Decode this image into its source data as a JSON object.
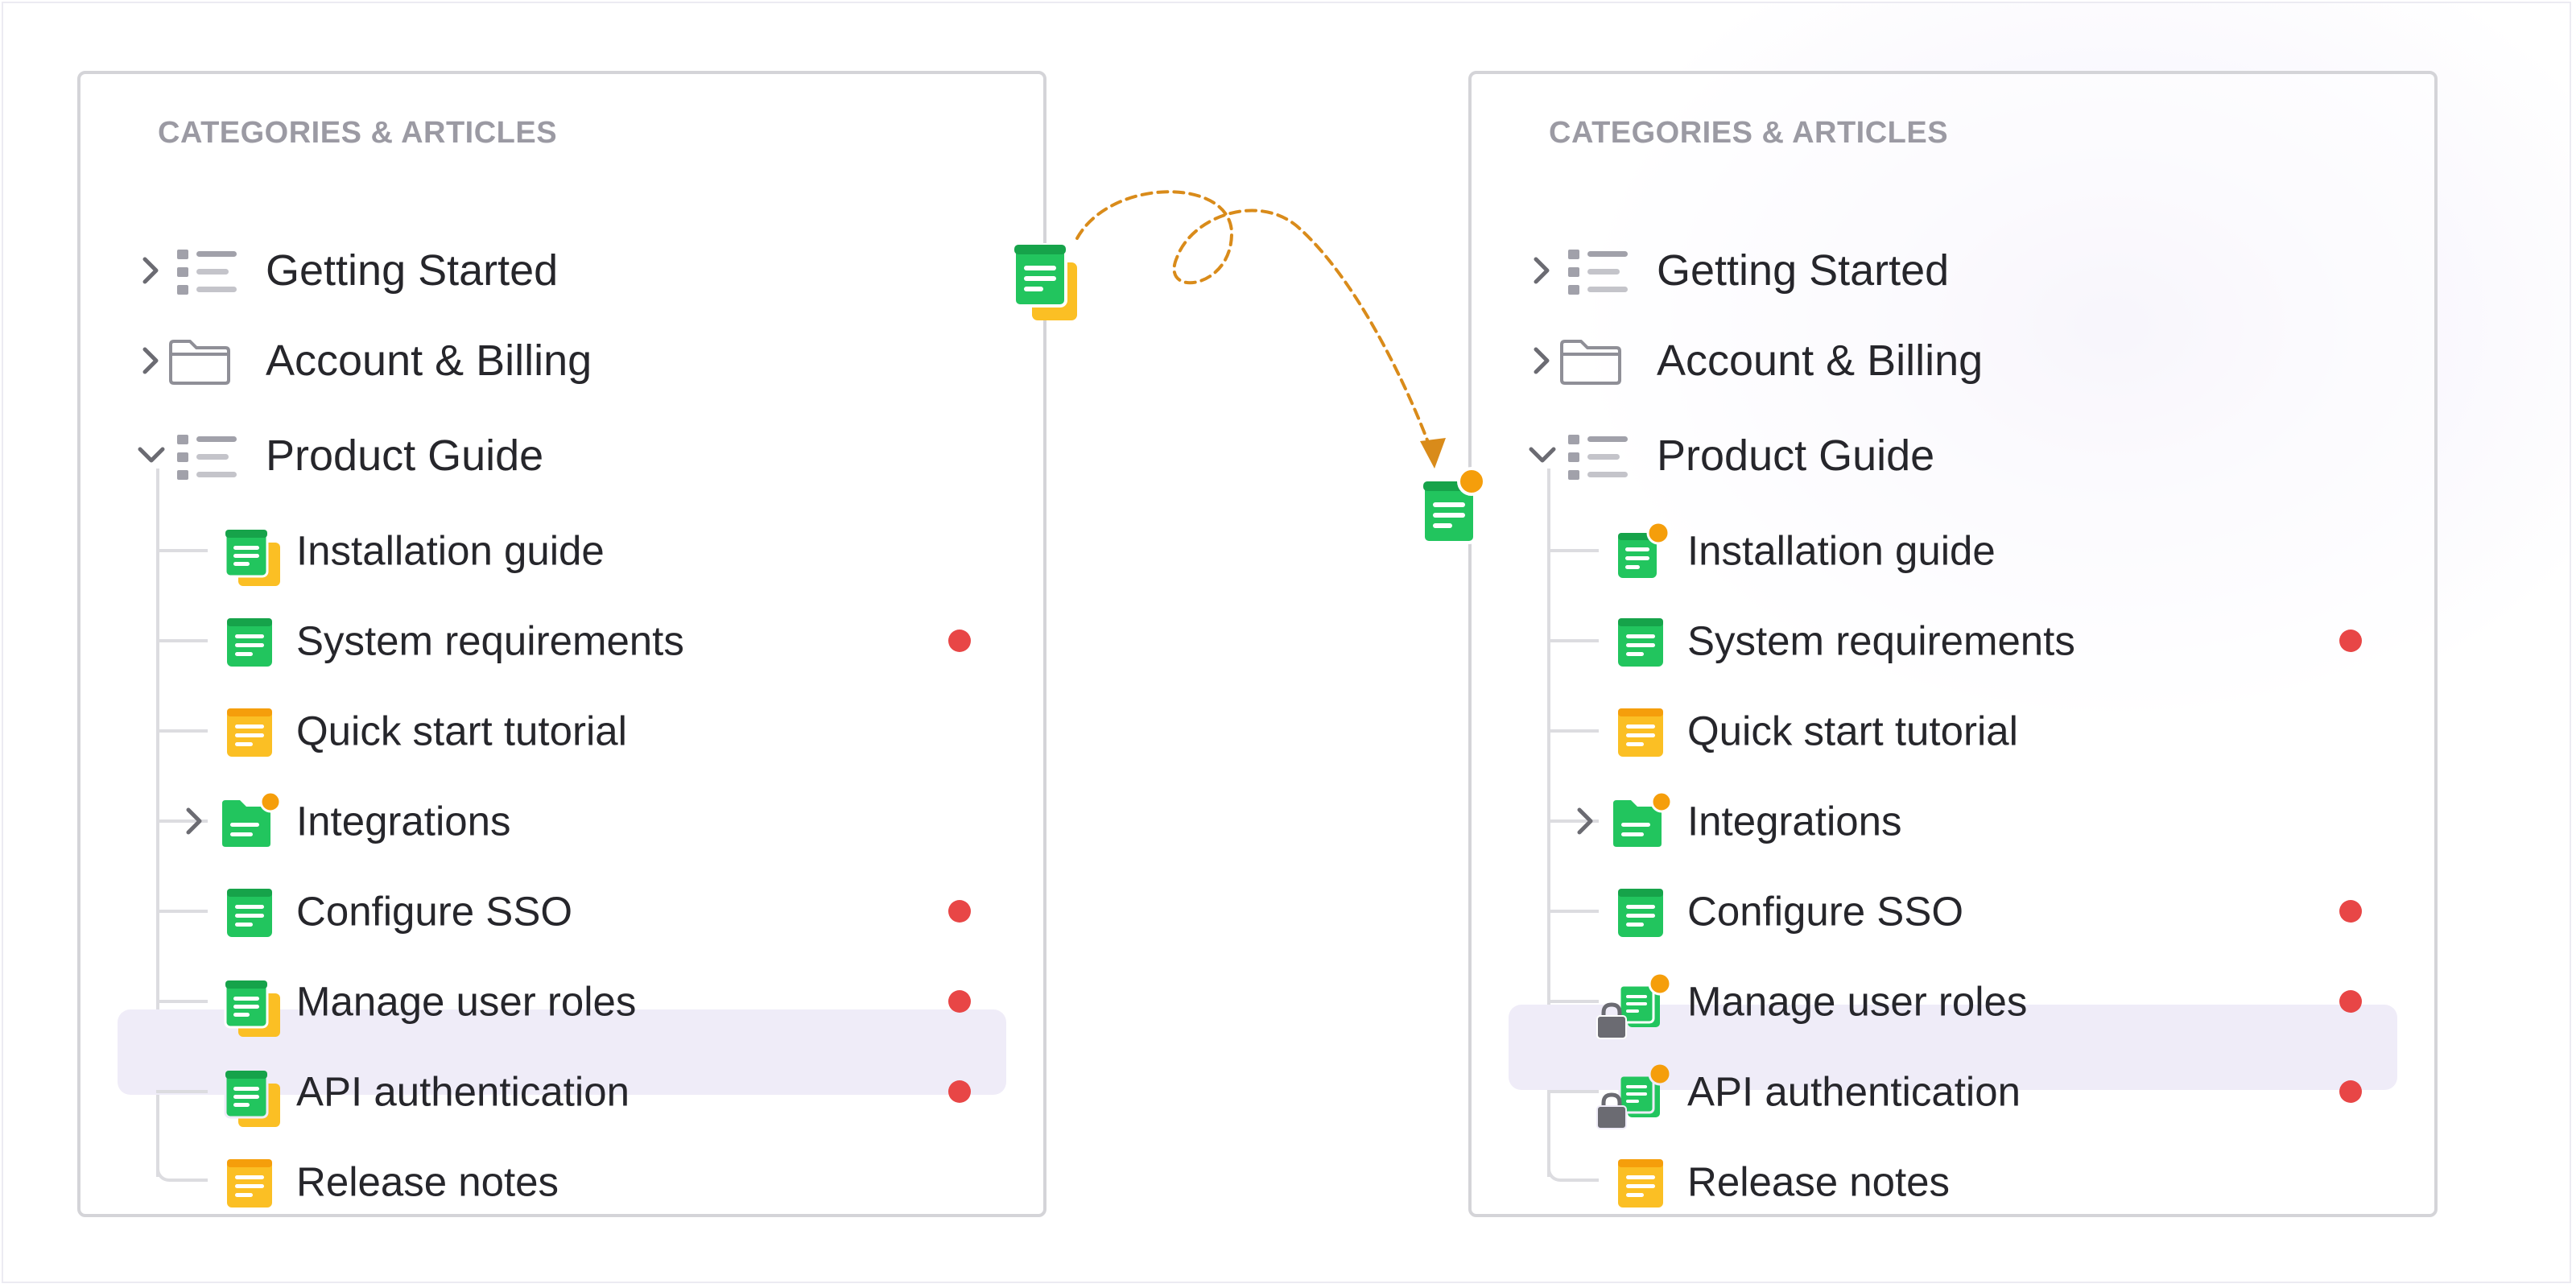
{
  "left_panel": {
    "title": "CATEGORIES & ARTICLES",
    "categories": [
      {
        "label": "Getting Started",
        "icon": "list-icon",
        "state": "collapsed"
      },
      {
        "label": "Account & Billing",
        "icon": "folder-icon",
        "state": "collapsed"
      },
      {
        "label": "Product Guide",
        "icon": "list-icon",
        "state": "expanded"
      }
    ],
    "articles": [
      {
        "label": "Installation guide",
        "icon": "stacked-doc-icon",
        "dot": false
      },
      {
        "label": "System requirements",
        "icon": "doc-icon-green",
        "dot": true
      },
      {
        "label": "Quick start tutorial",
        "icon": "doc-icon-yellow",
        "dot": false
      },
      {
        "label": "Integrations",
        "icon": "folder-doc-icon",
        "dot": false
      },
      {
        "label": "Configure SSO",
        "icon": "doc-icon-green",
        "dot": true
      },
      {
        "label": "Manage user roles",
        "icon": "stacked-doc-icon",
        "dot": true
      },
      {
        "label": "API authentication",
        "icon": "stacked-doc-icon",
        "dot": true,
        "highlighted": true
      },
      {
        "label": "Release notes",
        "icon": "doc-icon-yellow",
        "dot": false
      }
    ]
  },
  "right_panel": {
    "title": "CATEGORIES & ARTICLES",
    "categories": [
      {
        "label": "Getting Started",
        "icon": "list-icon",
        "state": "collapsed"
      },
      {
        "label": "Account & Billing",
        "icon": "folder-icon",
        "state": "collapsed"
      },
      {
        "label": "Product Guide",
        "icon": "list-icon",
        "state": "expanded"
      }
    ],
    "articles": [
      {
        "label": "Installation guide",
        "icon": "doc-badge-icon",
        "dot": false
      },
      {
        "label": "System requirements",
        "icon": "doc-icon-green",
        "dot": true
      },
      {
        "label": "Quick start tutorial",
        "icon": "doc-icon-yellow",
        "dot": false
      },
      {
        "label": "Integrations",
        "icon": "folder-doc-icon",
        "dot": false
      },
      {
        "label": "Configure SSO",
        "icon": "doc-icon-green",
        "dot": true
      },
      {
        "label": "Manage user roles",
        "icon": "locked-stacked-doc-icon",
        "dot": true
      },
      {
        "label": "API authentication",
        "icon": "locked-stacked-doc-icon",
        "dot": true,
        "highlighted": true
      },
      {
        "label": "Release notes",
        "icon": "doc-icon-yellow",
        "dot": false
      }
    ]
  },
  "colors": {
    "green": "#22c55e",
    "yellow": "#fbbf24",
    "badge": "#f59e0b",
    "dot": "#e84646",
    "highlight": "#efecf8",
    "arrow": "#d98b1a",
    "lock": "#6b6b72"
  }
}
